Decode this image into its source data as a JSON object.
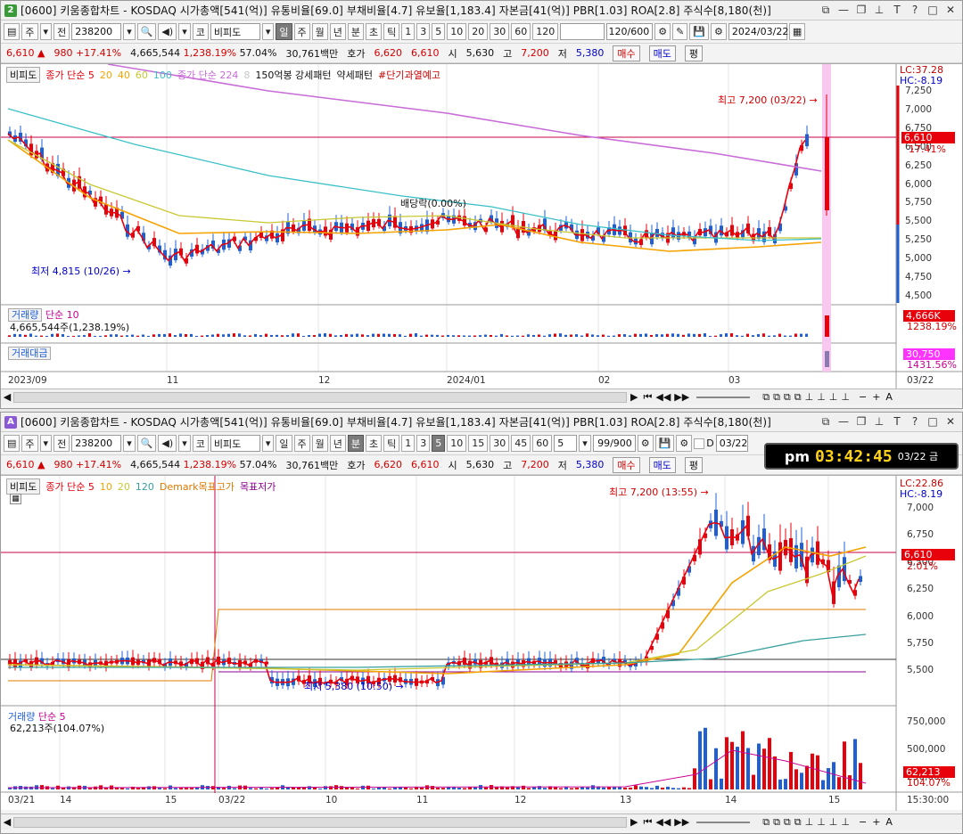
{
  "top": {
    "window_id": "2",
    "title": "[0600] 키움종합차트 - KOSDAQ 시가총액[541(억)] 유통비율[69.0] 부채비율[4.7] 유보율[1,183.4] 자본금[41(억)] PBR[1.03] ROA[2.8] 주식수[8,180(천)]",
    "toolbar": {
      "market": "주",
      "type": "전",
      "code": "238200",
      "market2": "코",
      "name": "비피도",
      "periods": [
        "일",
        "주",
        "월",
        "년",
        "분",
        "초",
        "틱"
      ],
      "selected_period": "일",
      "numbers": [
        "1",
        "3",
        "5",
        "10",
        "20",
        "30",
        "60",
        "120"
      ],
      "count": "120/600",
      "date": "2024/03/22"
    },
    "info": {
      "price": "6,610",
      "change": "980",
      "rate": "+17.41%",
      "volume": "4,665,544",
      "vol_rate": "1,238.19%",
      "pct": "57.04%",
      "amount": "30,761백만",
      "hoga_label": "호가",
      "ask": "6,620",
      "bid": "6,610",
      "open_label": "시",
      "open": "5,630",
      "high_label": "고",
      "high": "7,200",
      "low_label": "저",
      "low": "5,380",
      "buy": "매수",
      "sell": "매도",
      "eval": "평"
    },
    "legend": {
      "tag": "비피도",
      "ma1": "종가 단순 5",
      "ma_10": "20",
      "ma_20": "40",
      "ma_60": "60",
      "ma_100": "100",
      "ma2": "종가 단순 224",
      "ma2n": "8",
      "pattern": "150억봉 강세패턴",
      "pattern2": "약세패턴",
      "warn": "#단기과열예고"
    },
    "annotations": {
      "high": "최고 7,200 (03/22) →",
      "low": "최저 4,815 (10/26) →",
      "div": "배당락(0.00%)"
    },
    "right": {
      "lc": "LC:37.28",
      "hc": "HC:-8.19",
      "price_tag": "6,610",
      "pct_tag": "17.41%"
    },
    "yticks": [
      "7,250",
      "7,000",
      "6,750",
      "6,500",
      "6,250",
      "6,000",
      "5,750",
      "5,500",
      "5,250",
      "5,000",
      "4,750",
      "4,500"
    ],
    "vol": {
      "title": "거래량",
      "ma": "단순 10",
      "value": "4,665,544주(1,238.19%)",
      "tag": "4,666K",
      "tag2": "1238.19%"
    },
    "amt": {
      "title": "거래대금",
      "tag": "30,750",
      "tag2": "1431.56%"
    },
    "xticks": [
      "2023/09",
      "11",
      "12",
      "2024/01",
      "02",
      "03",
      "03/22"
    ]
  },
  "bottom": {
    "window_id": "A",
    "title": "[0600] 키움종합차트 - KOSDAQ 시가총액[541(억)] 유통비율[69.0] 부채비율[4.7] 유보율[1,183.4] 자본금[41(억)] PBR[1.03] ROA[2.8] 주식수[8,180(천)]",
    "toolbar": {
      "market": "주",
      "type": "전",
      "code": "238200",
      "market2": "코",
      "name": "비피도",
      "periods": [
        "일",
        "주",
        "월",
        "년",
        "분",
        "초",
        "틱"
      ],
      "selected_period": "분",
      "numbers": [
        "1",
        "3",
        "5",
        "10",
        "15",
        "30",
        "45",
        "60"
      ],
      "selected_number": "5",
      "interval": "5",
      "count": "99/900",
      "chk_label": "D",
      "date": "03/22"
    },
    "info": {
      "price": "6,610",
      "change": "980",
      "rate": "+17.41%",
      "volume": "4,665,544",
      "vol_rate": "1,238.19%",
      "pct": "57.04%",
      "amount": "30,761백만",
      "hoga_label": "호가",
      "ask": "6,620",
      "bid": "6,610",
      "open_label": "시",
      "open": "5,630",
      "high_label": "고",
      "high": "7,200",
      "low_label": "저",
      "low": "5,380",
      "buy": "매수",
      "sell": "매도",
      "eval": "평"
    },
    "clock": {
      "ampm": "pm",
      "time": "03:42:45",
      "date": "03/22 금"
    },
    "legend": {
      "tag": "비피도",
      "ma1": "종가 단순 5",
      "m10": "10",
      "m20": "20",
      "m120": "120",
      "demark": "Demark목표고가",
      "target": "목표저가"
    },
    "annotations": {
      "high": "최고 7,200 (13:55) →",
      "low": "최저 5,380 (10:50) →"
    },
    "right": {
      "lc": "LC:22.86",
      "hc": "HC:-8.19",
      "price_tag": "6,610",
      "pct_tag": "2.01%"
    },
    "yticks": [
      "7,000",
      "6,750",
      "6,500",
      "6,250",
      "6,000",
      "5,750",
      "5,500"
    ],
    "vol": {
      "title": "거래량",
      "ma": "단순 5",
      "value": "62,213주(104.07%)",
      "tag": "62,213",
      "tag2": "104.07%"
    },
    "vticks": [
      "750,000",
      "500,000",
      "250,000"
    ],
    "xticks": [
      "03/21",
      "14",
      "15",
      "03/22",
      "10",
      "11",
      "12",
      "13",
      "14",
      "15",
      "15:30:00"
    ]
  },
  "colors": {
    "up": "#e8000b",
    "down": "#1f5fd6",
    "ma5": "#e8000b",
    "ma20": "#f5a300",
    "ma224": "#c86bd8",
    "ma120": "#39c0c8",
    "target_red": "#c8004a"
  }
}
